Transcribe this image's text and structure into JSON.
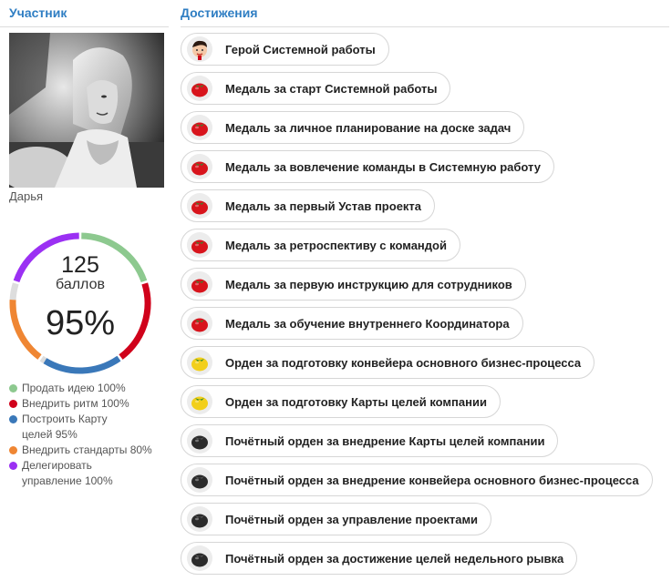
{
  "header": {
    "participant_col": "Участник",
    "achievements_col": "Достижения"
  },
  "participant": {
    "name": "Дарья"
  },
  "score": {
    "points": "125",
    "points_label": "баллов",
    "percent": "95%"
  },
  "progress_segments": [
    {
      "label": "Продать идею 100%",
      "value": 100,
      "color": "#8dc98f"
    },
    {
      "label": "Внедрить ритм 100%",
      "value": 100,
      "color": "#d0021b"
    },
    {
      "label": "Построить Карту целей 95%",
      "value": 95,
      "color": "#3a78b9"
    },
    {
      "label": "Внедрить стандарты 80%",
      "value": 80,
      "color": "#ef8633"
    },
    {
      "label": "Делегировать управление 100%",
      "value": 100,
      "color": "#9b30f3"
    }
  ],
  "legend": {
    "item0": "Продать идею 100%",
    "item1": "Внедрить ритм 100%",
    "item2": "Построить Карту целей 95%",
    "item3": "Внедрить стандарты 80%",
    "item4": "Делегировать управление 100%"
  },
  "achievements": [
    {
      "label": "Герой Системной работы",
      "icon": "hero-icon"
    },
    {
      "label": "Медаль за старт Системной работы",
      "icon": "red-tomato-icon"
    },
    {
      "label": "Медаль за личное планирование на доске задач",
      "icon": "red-tomato-icon"
    },
    {
      "label": "Медаль за вовлечение команды в Системную работу",
      "icon": "red-tomato-icon"
    },
    {
      "label": "Медаль за первый Устав проекта",
      "icon": "red-tomato-icon"
    },
    {
      "label": "Медаль за ретроспективу с командой",
      "icon": "red-tomato-icon"
    },
    {
      "label": "Медаль за первую инструкцию для сотрудников",
      "icon": "red-tomato-icon"
    },
    {
      "label": "Медаль за обучение внутреннего Координатора",
      "icon": "red-tomato-icon"
    },
    {
      "label": "Орден за подготовку конвейера основного бизнес-процесса",
      "icon": "yellow-tomato-icon"
    },
    {
      "label": "Орден за подготовку Карты целей компании",
      "icon": "yellow-tomato-icon"
    },
    {
      "label": "Почётный орден за внедрение Карты целей компании",
      "icon": "black-tomato-icon"
    },
    {
      "label": "Почётный орден за внедрение конвейера основного бизнес-процесса",
      "icon": "black-tomato-icon"
    },
    {
      "label": "Почётный орден за управление проектами",
      "icon": "black-tomato-icon"
    },
    {
      "label": "Почётный орден за достижение целей недельного рывка",
      "icon": "black-tomato-icon"
    }
  ]
}
